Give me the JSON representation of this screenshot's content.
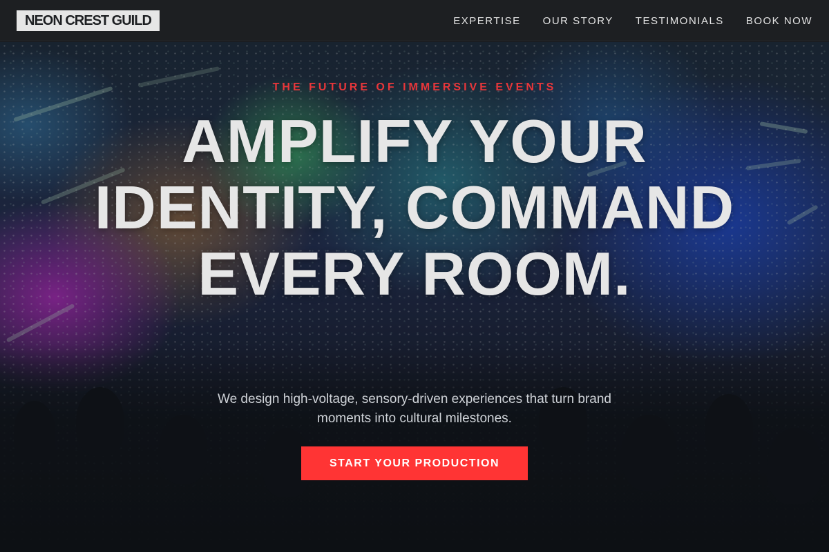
{
  "header": {
    "logo": "NEON CREST GUILD",
    "nav": [
      {
        "label": "EXPERTISE"
      },
      {
        "label": "OUR STORY"
      },
      {
        "label": "TESTIMONIALS"
      },
      {
        "label": "BOOK NOW"
      }
    ]
  },
  "hero": {
    "eyebrow": "THE FUTURE OF IMMERSIVE EVENTS",
    "headline": "AMPLIFY YOUR IDENTITY, COMMAND EVERY ROOM.",
    "subheadline": "We design high-voltage, sensory-driven experiences that turn brand moments into cultural milestones.",
    "cta_label": "START YOUR PRODUCTION"
  },
  "colors": {
    "accent": "#ff3434",
    "eyebrow": "#e8363a",
    "header_bg": "#1d1f22",
    "text_light": "#e6e6e6"
  }
}
